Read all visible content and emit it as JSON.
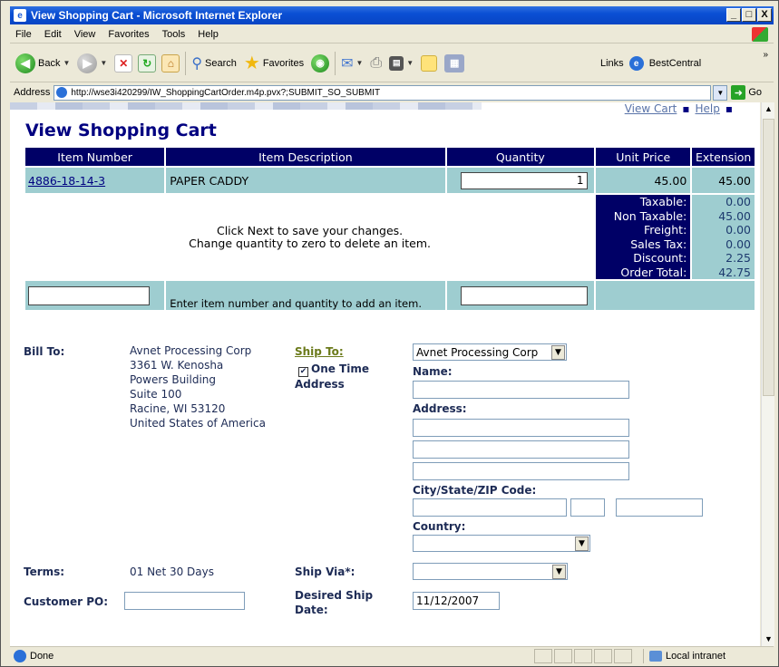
{
  "window": {
    "title": "View Shopping Cart - Microsoft Internet Explorer",
    "minimize": "_",
    "maximize": "□",
    "close": "X"
  },
  "menu": [
    "File",
    "Edit",
    "View",
    "Favorites",
    "Tools",
    "Help"
  ],
  "toolbar": {
    "back": "Back",
    "search": "Search",
    "favorites": "Favorites",
    "links": "Links",
    "bestcentral": "BestCentral"
  },
  "address": {
    "label": "Address",
    "url": "http://wse3i420299/IW_ShoppingCartOrder.m4p.pvx?;SUBMIT_SO_SUBMIT",
    "go": "Go"
  },
  "page": {
    "title": "View Shopping Cart",
    "top_links": [
      "View Cart",
      "Help"
    ]
  },
  "cart": {
    "headers": [
      "Item Number",
      "Item Description",
      "Quantity",
      "Unit Price",
      "Extension"
    ],
    "items": [
      {
        "number": "4886-18-14-3",
        "description": "PAPER CADDY",
        "quantity": "1",
        "unit_price": "45.00",
        "extension": "45.00"
      }
    ],
    "message_line1": "Click Next to save your changes.",
    "message_line2": "Change quantity to zero to delete an item.",
    "totals": [
      {
        "label": "Taxable:",
        "value": "0.00"
      },
      {
        "label": "Non Taxable:",
        "value": "45.00"
      },
      {
        "label": "Freight:",
        "value": "0.00"
      },
      {
        "label": "Sales Tax:",
        "value": "0.00"
      },
      {
        "label": "Discount:",
        "value": "2.25"
      },
      {
        "label": "Order Total:",
        "value": "42.75"
      }
    ],
    "add_hint": "Enter item number and quantity to add an item."
  },
  "order": {
    "bill_to_label": "Bill To:",
    "bill_to": [
      "Avnet Processing Corp",
      "3361 W. Kenosha",
      "Powers Building",
      "Suite 100",
      "Racine, WI  53120",
      "United States of America"
    ],
    "ship_to_label": "Ship To:",
    "one_time": "One Time",
    "address_word": "Address",
    "ship_to_select": "Avnet Processing Corp",
    "name_label": "Name:",
    "address_label": "Address:",
    "city_label": "City/State/ZIP Code:",
    "country_label": "Country:",
    "terms_label": "Terms:",
    "terms_value": "01  Net 30 Days",
    "ship_via_label": "Ship Via*:",
    "customer_po_label": "Customer PO:",
    "desired_ship_label_1": "Desired Ship",
    "desired_ship_label_2": "Date:",
    "desired_ship_date": "11/12/2007"
  },
  "status": {
    "text": "Done",
    "zone": "Local intranet"
  }
}
